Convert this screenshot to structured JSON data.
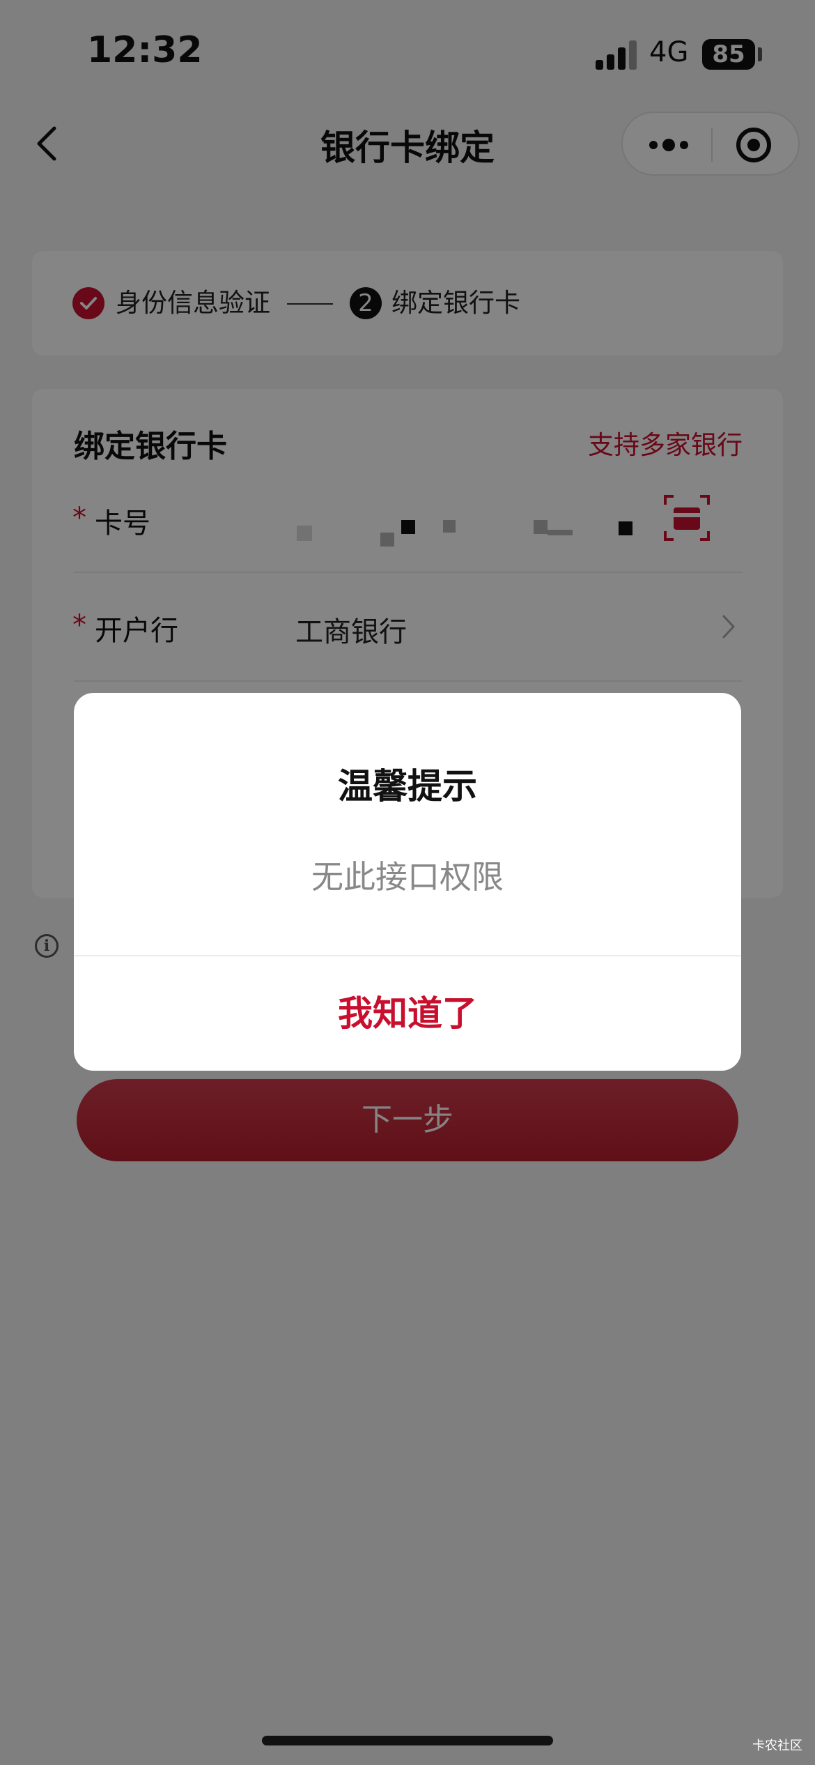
{
  "status_bar": {
    "time": "12:32",
    "network": "4G",
    "battery": "85"
  },
  "nav": {
    "title": "银行卡绑定"
  },
  "steps": [
    {
      "label": "身份信息验证",
      "state": "done"
    },
    {
      "number": "2",
      "label": "绑定银行卡",
      "state": "current"
    }
  ],
  "form": {
    "title": "绑定银行卡",
    "support_link": "支持多家银行",
    "card_number_label": "卡号",
    "bank_label": "开户行",
    "bank_value": "工商银行",
    "required_mark": "*"
  },
  "next_button": "下一步",
  "dialog": {
    "title": "温馨提示",
    "message": "无此接口权限",
    "button": "我知道了"
  },
  "watermark": "卡农社区",
  "colors": {
    "accent": "#c8102e",
    "overlay": "rgba(0,0,0,0.48)"
  },
  "icons": [
    "back-icon",
    "more-icon",
    "close-target-icon",
    "check-icon",
    "scan-card-icon",
    "chevron-right-icon",
    "info-icon"
  ]
}
